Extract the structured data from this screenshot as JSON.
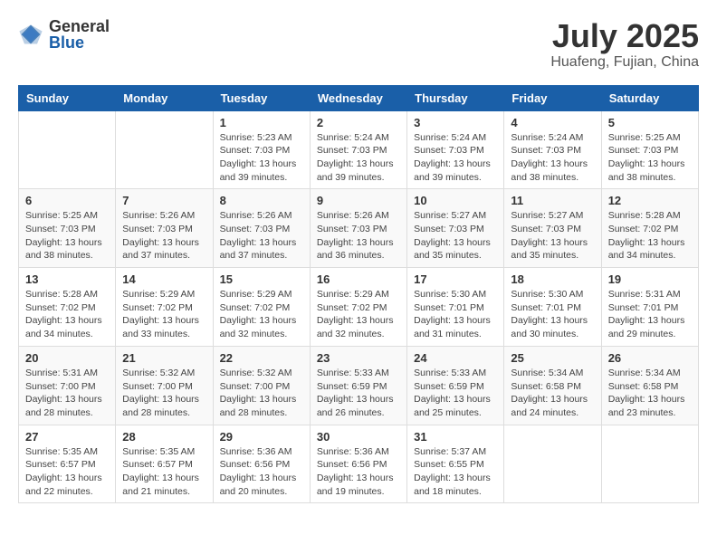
{
  "header": {
    "logo": {
      "general": "General",
      "blue": "Blue"
    },
    "title": "July 2025",
    "location": "Huafeng, Fujian, China"
  },
  "weekdays": [
    "Sunday",
    "Monday",
    "Tuesday",
    "Wednesday",
    "Thursday",
    "Friday",
    "Saturday"
  ],
  "weeks": [
    [
      {
        "day": "",
        "info": ""
      },
      {
        "day": "",
        "info": ""
      },
      {
        "day": "1",
        "sunrise": "Sunrise: 5:23 AM",
        "sunset": "Sunset: 7:03 PM",
        "daylight": "Daylight: 13 hours and 39 minutes."
      },
      {
        "day": "2",
        "sunrise": "Sunrise: 5:24 AM",
        "sunset": "Sunset: 7:03 PM",
        "daylight": "Daylight: 13 hours and 39 minutes."
      },
      {
        "day": "3",
        "sunrise": "Sunrise: 5:24 AM",
        "sunset": "Sunset: 7:03 PM",
        "daylight": "Daylight: 13 hours and 39 minutes."
      },
      {
        "day": "4",
        "sunrise": "Sunrise: 5:24 AM",
        "sunset": "Sunset: 7:03 PM",
        "daylight": "Daylight: 13 hours and 38 minutes."
      },
      {
        "day": "5",
        "sunrise": "Sunrise: 5:25 AM",
        "sunset": "Sunset: 7:03 PM",
        "daylight": "Daylight: 13 hours and 38 minutes."
      }
    ],
    [
      {
        "day": "6",
        "sunrise": "Sunrise: 5:25 AM",
        "sunset": "Sunset: 7:03 PM",
        "daylight": "Daylight: 13 hours and 38 minutes."
      },
      {
        "day": "7",
        "sunrise": "Sunrise: 5:26 AM",
        "sunset": "Sunset: 7:03 PM",
        "daylight": "Daylight: 13 hours and 37 minutes."
      },
      {
        "day": "8",
        "sunrise": "Sunrise: 5:26 AM",
        "sunset": "Sunset: 7:03 PM",
        "daylight": "Daylight: 13 hours and 37 minutes."
      },
      {
        "day": "9",
        "sunrise": "Sunrise: 5:26 AM",
        "sunset": "Sunset: 7:03 PM",
        "daylight": "Daylight: 13 hours and 36 minutes."
      },
      {
        "day": "10",
        "sunrise": "Sunrise: 5:27 AM",
        "sunset": "Sunset: 7:03 PM",
        "daylight": "Daylight: 13 hours and 35 minutes."
      },
      {
        "day": "11",
        "sunrise": "Sunrise: 5:27 AM",
        "sunset": "Sunset: 7:03 PM",
        "daylight": "Daylight: 13 hours and 35 minutes."
      },
      {
        "day": "12",
        "sunrise": "Sunrise: 5:28 AM",
        "sunset": "Sunset: 7:02 PM",
        "daylight": "Daylight: 13 hours and 34 minutes."
      }
    ],
    [
      {
        "day": "13",
        "sunrise": "Sunrise: 5:28 AM",
        "sunset": "Sunset: 7:02 PM",
        "daylight": "Daylight: 13 hours and 34 minutes."
      },
      {
        "day": "14",
        "sunrise": "Sunrise: 5:29 AM",
        "sunset": "Sunset: 7:02 PM",
        "daylight": "Daylight: 13 hours and 33 minutes."
      },
      {
        "day": "15",
        "sunrise": "Sunrise: 5:29 AM",
        "sunset": "Sunset: 7:02 PM",
        "daylight": "Daylight: 13 hours and 32 minutes."
      },
      {
        "day": "16",
        "sunrise": "Sunrise: 5:29 AM",
        "sunset": "Sunset: 7:02 PM",
        "daylight": "Daylight: 13 hours and 32 minutes."
      },
      {
        "day": "17",
        "sunrise": "Sunrise: 5:30 AM",
        "sunset": "Sunset: 7:01 PM",
        "daylight": "Daylight: 13 hours and 31 minutes."
      },
      {
        "day": "18",
        "sunrise": "Sunrise: 5:30 AM",
        "sunset": "Sunset: 7:01 PM",
        "daylight": "Daylight: 13 hours and 30 minutes."
      },
      {
        "day": "19",
        "sunrise": "Sunrise: 5:31 AM",
        "sunset": "Sunset: 7:01 PM",
        "daylight": "Daylight: 13 hours and 29 minutes."
      }
    ],
    [
      {
        "day": "20",
        "sunrise": "Sunrise: 5:31 AM",
        "sunset": "Sunset: 7:00 PM",
        "daylight": "Daylight: 13 hours and 28 minutes."
      },
      {
        "day": "21",
        "sunrise": "Sunrise: 5:32 AM",
        "sunset": "Sunset: 7:00 PM",
        "daylight": "Daylight: 13 hours and 28 minutes."
      },
      {
        "day": "22",
        "sunrise": "Sunrise: 5:32 AM",
        "sunset": "Sunset: 7:00 PM",
        "daylight": "Daylight: 13 hours and 28 minutes."
      },
      {
        "day": "23",
        "sunrise": "Sunrise: 5:33 AM",
        "sunset": "Sunset: 6:59 PM",
        "daylight": "Daylight: 13 hours and 26 minutes."
      },
      {
        "day": "24",
        "sunrise": "Sunrise: 5:33 AM",
        "sunset": "Sunset: 6:59 PM",
        "daylight": "Daylight: 13 hours and 25 minutes."
      },
      {
        "day": "25",
        "sunrise": "Sunrise: 5:34 AM",
        "sunset": "Sunset: 6:58 PM",
        "daylight": "Daylight: 13 hours and 24 minutes."
      },
      {
        "day": "26",
        "sunrise": "Sunrise: 5:34 AM",
        "sunset": "Sunset: 6:58 PM",
        "daylight": "Daylight: 13 hours and 23 minutes."
      }
    ],
    [
      {
        "day": "27",
        "sunrise": "Sunrise: 5:35 AM",
        "sunset": "Sunset: 6:57 PM",
        "daylight": "Daylight: 13 hours and 22 minutes."
      },
      {
        "day": "28",
        "sunrise": "Sunrise: 5:35 AM",
        "sunset": "Sunset: 6:57 PM",
        "daylight": "Daylight: 13 hours and 21 minutes."
      },
      {
        "day": "29",
        "sunrise": "Sunrise: 5:36 AM",
        "sunset": "Sunset: 6:56 PM",
        "daylight": "Daylight: 13 hours and 20 minutes."
      },
      {
        "day": "30",
        "sunrise": "Sunrise: 5:36 AM",
        "sunset": "Sunset: 6:56 PM",
        "daylight": "Daylight: 13 hours and 19 minutes."
      },
      {
        "day": "31",
        "sunrise": "Sunrise: 5:37 AM",
        "sunset": "Sunset: 6:55 PM",
        "daylight": "Daylight: 13 hours and 18 minutes."
      },
      {
        "day": "",
        "info": ""
      },
      {
        "day": "",
        "info": ""
      }
    ]
  ]
}
